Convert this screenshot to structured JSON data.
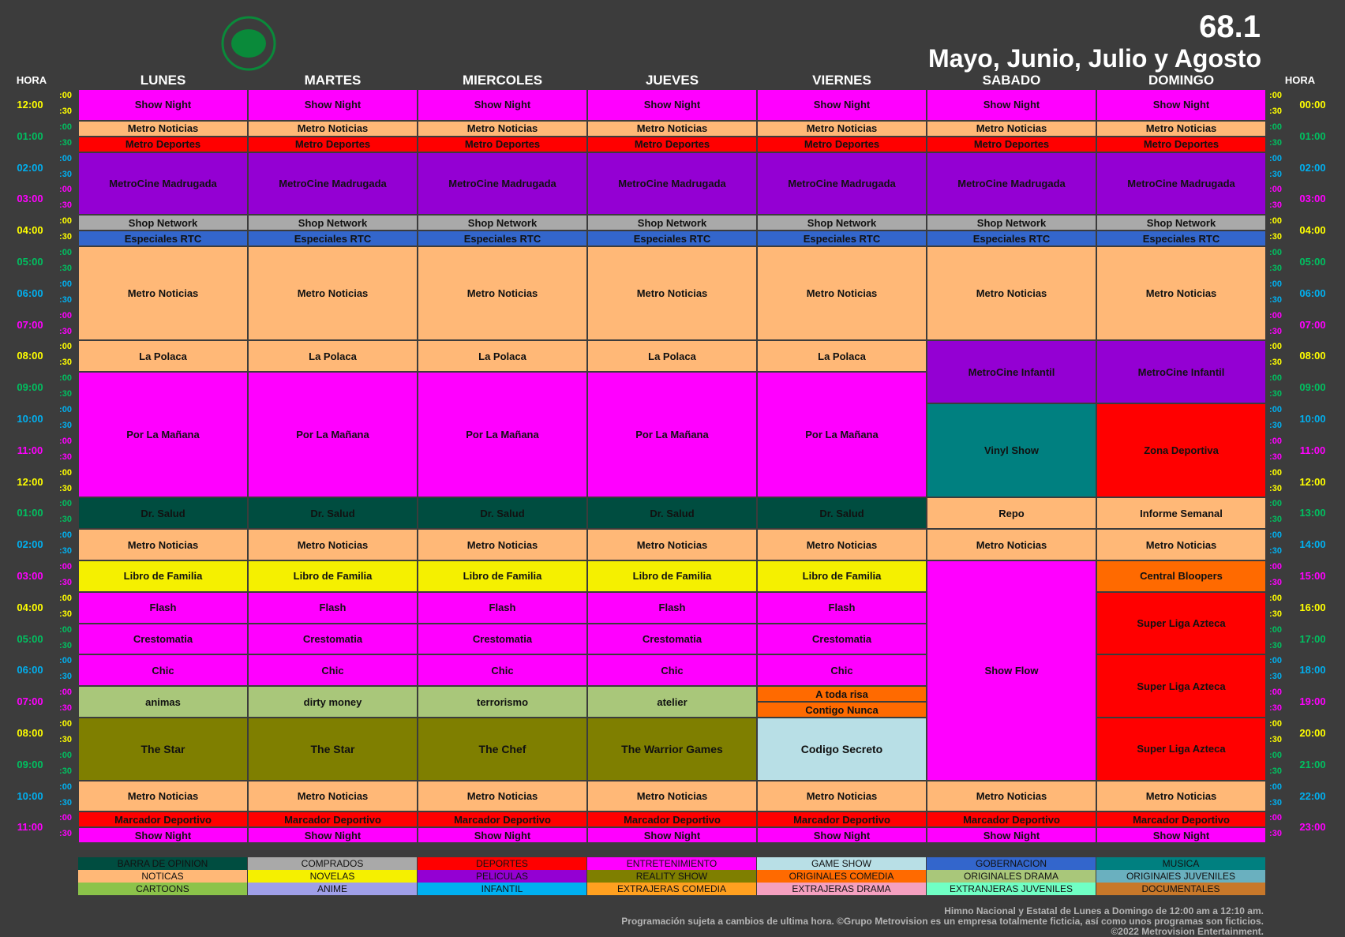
{
  "header": {
    "channel": "68.1",
    "period": "Mayo, Junio, Julio y Agosto",
    "hora_label": "HORA",
    "days": [
      "LUNES",
      "MARTES",
      "MIERCOLES",
      "JUEVES",
      "VIERNES",
      "SABADO",
      "DOMINGO"
    ]
  },
  "colors": {
    "ent": "#ff00ff",
    "not": "#ffb877",
    "dep": "#ff0000",
    "pel": "#9400d3",
    "com": "#a9a9a9",
    "gob": "#3366cc",
    "bar": "#004d40",
    "nov": "#f5f000",
    "org": "#a9c77a",
    "rea": "#7f7f00",
    "gam": "#b8dfe6",
    "oco": "#ff6a00",
    "mus": "#008080",
    "oju": "#6ab0bf",
    "car": "#8bc34a",
    "ani": "#9f9fe8",
    "inf": "#00b0f0",
    "exc": "#ffa020",
    "exd": "#f4a0c0",
    "exj": "#70ffc4",
    "doc": "#c8782a"
  },
  "time_labels_left": [
    {
      "t": "12:00",
      "c": "#ffff00"
    },
    {
      "t": "01:00",
      "c": "#00c060"
    },
    {
      "t": "02:00",
      "c": "#00b0f0"
    },
    {
      "t": "03:00",
      "c": "#ff00ff"
    },
    {
      "t": "04:00",
      "c": "#ffff00"
    },
    {
      "t": "05:00",
      "c": "#00c060"
    },
    {
      "t": "06:00",
      "c": "#00b0f0"
    },
    {
      "t": "07:00",
      "c": "#ff00ff"
    },
    {
      "t": "08:00",
      "c": "#ffff00"
    },
    {
      "t": "09:00",
      "c": "#00c060"
    },
    {
      "t": "10:00",
      "c": "#00b0f0"
    },
    {
      "t": "11:00",
      "c": "#ff00ff"
    },
    {
      "t": "12:00",
      "c": "#ffff00"
    },
    {
      "t": "01:00",
      "c": "#00c060"
    },
    {
      "t": "02:00",
      "c": "#00b0f0"
    },
    {
      "t": "03:00",
      "c": "#ff00ff"
    },
    {
      "t": "04:00",
      "c": "#ffff00"
    },
    {
      "t": "05:00",
      "c": "#00c060"
    },
    {
      "t": "06:00",
      "c": "#00b0f0"
    },
    {
      "t": "07:00",
      "c": "#ff00ff"
    },
    {
      "t": "08:00",
      "c": "#ffff00"
    },
    {
      "t": "09:00",
      "c": "#00c060"
    },
    {
      "t": "10:00",
      "c": "#00b0f0"
    },
    {
      "t": "11:00",
      "c": "#ff00ff"
    }
  ],
  "time_labels_right": [
    "00:00",
    "01:00",
    "02:00",
    "03:00",
    "04:00",
    "05:00",
    "06:00",
    "07:00",
    "08:00",
    "09:00",
    "10:00",
    "11:00",
    "12:00",
    "13:00",
    "14:00",
    "15:00",
    "16:00",
    "17:00",
    "18:00",
    "19:00",
    "20:00",
    "21:00",
    "22:00",
    "23:00"
  ],
  "minute_labels": [
    ":00",
    ":30"
  ],
  "schedule": {
    "weekday": [
      [
        [
          0,
          2,
          "Show Night",
          "ent"
        ],
        [
          2,
          1,
          "Metro Noticias",
          "not"
        ],
        [
          3,
          1,
          "Metro Deportes",
          "dep"
        ],
        [
          4,
          4,
          "MetroCine Madrugada",
          "pel"
        ],
        [
          8,
          1,
          "Shop Network",
          "com"
        ],
        [
          9,
          1,
          "Especiales RTC",
          "gob"
        ],
        [
          10,
          6,
          "Metro Noticias",
          "not"
        ],
        [
          16,
          2,
          "La Polaca",
          "not"
        ],
        [
          18,
          8,
          "Por La Mañana",
          "ent"
        ],
        [
          26,
          2,
          "Dr. Salud",
          "bar"
        ],
        [
          28,
          2,
          "Metro Noticias",
          "not"
        ],
        [
          30,
          2,
          "Libro de Familia",
          "nov"
        ],
        [
          32,
          2,
          "Flash",
          "ent"
        ],
        [
          34,
          2,
          "Crestomatia",
          "ent"
        ],
        [
          36,
          2,
          "Chic",
          "ent"
        ],
        [
          38,
          2,
          "animas",
          "org"
        ],
        [
          40,
          4,
          "The Star",
          "rea"
        ],
        [
          44,
          2,
          "Metro Noticias",
          "not"
        ],
        [
          46,
          1,
          "Marcador Deportivo",
          "dep"
        ],
        [
          47,
          1,
          "Show Night",
          "ent"
        ]
      ],
      [
        [
          0,
          2,
          "Show Night",
          "ent"
        ],
        [
          2,
          1,
          "Metro Noticias",
          "not"
        ],
        [
          3,
          1,
          "Metro Deportes",
          "dep"
        ],
        [
          4,
          4,
          "MetroCine Madrugada",
          "pel"
        ],
        [
          8,
          1,
          "Shop Network",
          "com"
        ],
        [
          9,
          1,
          "Especiales RTC",
          "gob"
        ],
        [
          10,
          6,
          "Metro Noticias",
          "not"
        ],
        [
          16,
          2,
          "La Polaca",
          "not"
        ],
        [
          18,
          8,
          "Por La Mañana",
          "ent"
        ],
        [
          26,
          2,
          "Dr. Salud",
          "bar"
        ],
        [
          28,
          2,
          "Metro Noticias",
          "not"
        ],
        [
          30,
          2,
          "Libro de Familia",
          "nov"
        ],
        [
          32,
          2,
          "Flash",
          "ent"
        ],
        [
          34,
          2,
          "Crestomatia",
          "ent"
        ],
        [
          36,
          2,
          "Chic",
          "ent"
        ],
        [
          38,
          2,
          "dirty money",
          "org"
        ],
        [
          40,
          4,
          "The Star",
          "rea"
        ],
        [
          44,
          2,
          "Metro Noticias",
          "not"
        ],
        [
          46,
          1,
          "Marcador Deportivo",
          "dep"
        ],
        [
          47,
          1,
          "Show Night",
          "ent"
        ]
      ],
      [
        [
          0,
          2,
          "Show Night",
          "ent"
        ],
        [
          2,
          1,
          "Metro Noticias",
          "not"
        ],
        [
          3,
          1,
          "Metro Deportes",
          "dep"
        ],
        [
          4,
          4,
          "MetroCine Madrugada",
          "pel"
        ],
        [
          8,
          1,
          "Shop Network",
          "com"
        ],
        [
          9,
          1,
          "Especiales RTC",
          "gob"
        ],
        [
          10,
          6,
          "Metro Noticias",
          "not"
        ],
        [
          16,
          2,
          "La Polaca",
          "not"
        ],
        [
          18,
          8,
          "Por La Mañana",
          "ent"
        ],
        [
          26,
          2,
          "Dr. Salud",
          "bar"
        ],
        [
          28,
          2,
          "Metro Noticias",
          "not"
        ],
        [
          30,
          2,
          "Libro de Familia",
          "nov"
        ],
        [
          32,
          2,
          "Flash",
          "ent"
        ],
        [
          34,
          2,
          "Crestomatia",
          "ent"
        ],
        [
          36,
          2,
          "Chic",
          "ent"
        ],
        [
          38,
          2,
          "terrorismo",
          "org"
        ],
        [
          40,
          4,
          "The Chef",
          "rea"
        ],
        [
          44,
          2,
          "Metro Noticias",
          "not"
        ],
        [
          46,
          1,
          "Marcador Deportivo",
          "dep"
        ],
        [
          47,
          1,
          "Show Night",
          "ent"
        ]
      ],
      [
        [
          0,
          2,
          "Show Night",
          "ent"
        ],
        [
          2,
          1,
          "Metro Noticias",
          "not"
        ],
        [
          3,
          1,
          "Metro Deportes",
          "dep"
        ],
        [
          4,
          4,
          "MetroCine Madrugada",
          "pel"
        ],
        [
          8,
          1,
          "Shop Network",
          "com"
        ],
        [
          9,
          1,
          "Especiales RTC",
          "gob"
        ],
        [
          10,
          6,
          "Metro Noticias",
          "not"
        ],
        [
          16,
          2,
          "La Polaca",
          "not"
        ],
        [
          18,
          8,
          "Por La Mañana",
          "ent"
        ],
        [
          26,
          2,
          "Dr. Salud",
          "bar"
        ],
        [
          28,
          2,
          "Metro Noticias",
          "not"
        ],
        [
          30,
          2,
          "Libro de Familia",
          "nov"
        ],
        [
          32,
          2,
          "Flash",
          "ent"
        ],
        [
          34,
          2,
          "Crestomatia",
          "ent"
        ],
        [
          36,
          2,
          "Chic",
          "ent"
        ],
        [
          38,
          2,
          "atelier",
          "org"
        ],
        [
          40,
          4,
          "The Warrior Games",
          "rea"
        ],
        [
          44,
          2,
          "Metro Noticias",
          "not"
        ],
        [
          46,
          1,
          "Marcador Deportivo",
          "dep"
        ],
        [
          47,
          1,
          "Show Night",
          "ent"
        ]
      ],
      [
        [
          0,
          2,
          "Show Night",
          "ent"
        ],
        [
          2,
          1,
          "Metro Noticias",
          "not"
        ],
        [
          3,
          1,
          "Metro Deportes",
          "dep"
        ],
        [
          4,
          4,
          "MetroCine Madrugada",
          "pel"
        ],
        [
          8,
          1,
          "Shop Network",
          "com"
        ],
        [
          9,
          1,
          "Especiales RTC",
          "gob"
        ],
        [
          10,
          6,
          "Metro Noticias",
          "not"
        ],
        [
          16,
          2,
          "La Polaca",
          "not"
        ],
        [
          18,
          8,
          "Por La Mañana",
          "ent"
        ],
        [
          26,
          2,
          "Dr. Salud",
          "bar"
        ],
        [
          28,
          2,
          "Metro Noticias",
          "not"
        ],
        [
          30,
          2,
          "Libro de Familia",
          "nov"
        ],
        [
          32,
          2,
          "Flash",
          "ent"
        ],
        [
          34,
          2,
          "Crestomatia",
          "ent"
        ],
        [
          36,
          2,
          "Chic",
          "ent"
        ],
        [
          38,
          1,
          "A toda risa",
          "oco"
        ],
        [
          39,
          1,
          "Contigo Nunca",
          "oco"
        ],
        [
          40,
          4,
          "Codigo Secreto",
          "gam"
        ],
        [
          44,
          2,
          "Metro Noticias",
          "not"
        ],
        [
          46,
          1,
          "Marcador Deportivo",
          "dep"
        ],
        [
          47,
          1,
          "Show Night",
          "ent"
        ]
      ],
      [
        [
          0,
          2,
          "Show Night",
          "ent"
        ],
        [
          2,
          1,
          "Metro Noticias",
          "not"
        ],
        [
          3,
          1,
          "Metro Deportes",
          "dep"
        ],
        [
          4,
          4,
          "MetroCine Madrugada",
          "pel"
        ],
        [
          8,
          1,
          "Shop Network",
          "com"
        ],
        [
          9,
          1,
          "Especiales RTC",
          "gob"
        ],
        [
          10,
          6,
          "Metro Noticias",
          "not"
        ],
        [
          16,
          4,
          "MetroCine Infantil",
          "pel"
        ],
        [
          20,
          6,
          "Vinyl Show",
          "mus"
        ],
        [
          26,
          2,
          "Repo",
          "not"
        ],
        [
          28,
          2,
          "Metro Noticias",
          "not"
        ],
        [
          30,
          14,
          "Show Flow",
          "ent"
        ],
        [
          44,
          2,
          "Metro Noticias",
          "not"
        ],
        [
          46,
          1,
          "Marcador Deportivo",
          "dep"
        ],
        [
          47,
          1,
          "Show Night",
          "ent"
        ]
      ],
      [
        [
          0,
          2,
          "Show Night",
          "ent"
        ],
        [
          2,
          1,
          "Metro Noticias",
          "not"
        ],
        [
          3,
          1,
          "Metro Deportes",
          "dep"
        ],
        [
          4,
          4,
          "MetroCine Madrugada",
          "pel"
        ],
        [
          8,
          1,
          "Shop Network",
          "com"
        ],
        [
          9,
          1,
          "Especiales RTC",
          "gob"
        ],
        [
          10,
          6,
          "Metro Noticias",
          "not"
        ],
        [
          16,
          4,
          "MetroCine Infantil",
          "pel"
        ],
        [
          20,
          6,
          "Zona Deportiva",
          "dep"
        ],
        [
          26,
          2,
          "Informe Semanal",
          "not"
        ],
        [
          28,
          2,
          "Metro Noticias",
          "not"
        ],
        [
          30,
          2,
          "Central Bloopers",
          "oco"
        ],
        [
          32,
          4,
          "Super Liga Azteca",
          "dep"
        ],
        [
          36,
          4,
          "Super Liga Azteca",
          "dep"
        ],
        [
          40,
          4,
          "Super Liga Azteca",
          "dep"
        ],
        [
          44,
          2,
          "Metro Noticias",
          "not"
        ],
        [
          46,
          1,
          "Marcador Deportivo",
          "dep"
        ],
        [
          47,
          1,
          "Show Night",
          "ent"
        ]
      ]
    ]
  },
  "legend": [
    [
      [
        "BARRA DE OPINION",
        "bar"
      ],
      [
        "COMPRADOS",
        "com"
      ],
      [
        "DEPORTES",
        "dep"
      ],
      [
        "ENTRETENIMIENTO",
        "ent"
      ],
      [
        "GAME SHOW",
        "gam"
      ],
      [
        "GOBERNACION",
        "gob"
      ],
      [
        "MUSICA",
        "mus"
      ]
    ],
    [
      [
        "NOTICAS",
        "not"
      ],
      [
        "NOVELAS",
        "nov"
      ],
      [
        "PELICULAS",
        "pel"
      ],
      [
        "REALITY SHOW",
        "rea"
      ],
      [
        "ORIGINALES COMEDIA",
        "oco"
      ],
      [
        "ORIGINALES DRAMA",
        "org"
      ],
      [
        "ORIGINAlES JUVENILES",
        "oju"
      ]
    ],
    [
      [
        "CARTOONS",
        "car"
      ],
      [
        "ANIME",
        "ani"
      ],
      [
        "INFANTIL",
        "inf"
      ],
      [
        "EXTRAJERAS COMEDIA",
        "exc"
      ],
      [
        "EXTRAJERAS DRAMA",
        "exd"
      ],
      [
        "EXTRANJERAS JUVENILES",
        "exj"
      ],
      [
        "DOCUMENTALES",
        "doc"
      ]
    ]
  ],
  "footer": [
    "Himno Nacional y Estatal de Lunes a Domingo de 12:00 am a 12:10 am.",
    "Programación sujeta a cambios de ultima hora. ©Grupo Metrovision es un empresa totalmente ficticia, así como unos programas son ficticios.",
    "©2022 Metrovision Entertainment."
  ]
}
